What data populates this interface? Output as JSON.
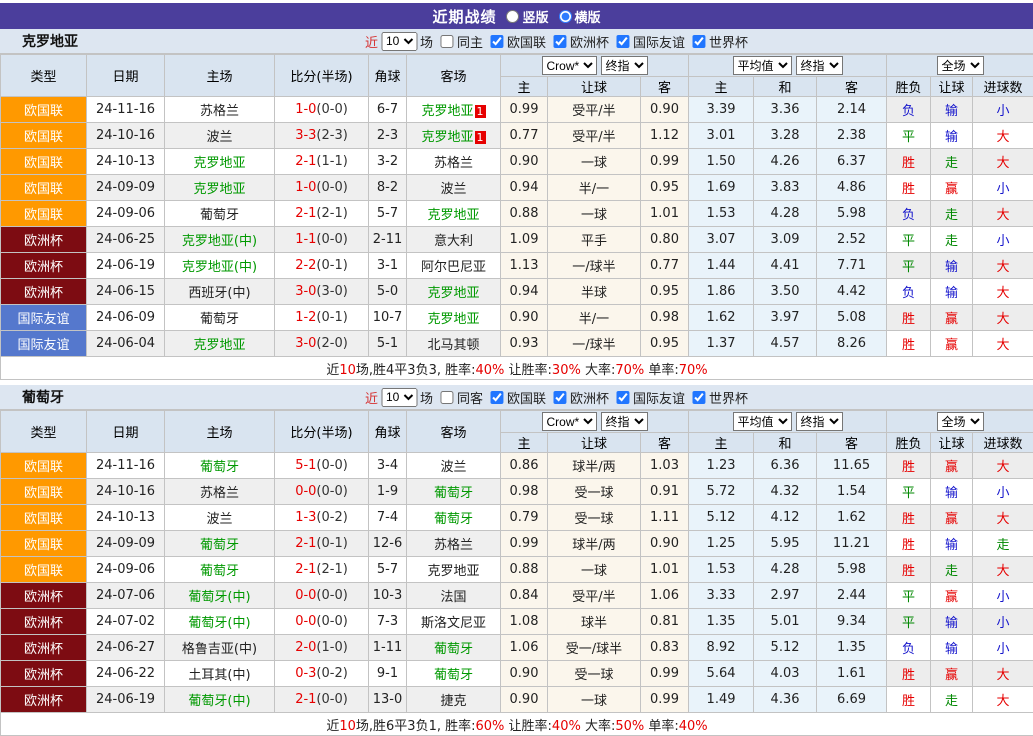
{
  "title_bar": {
    "title": "近期战绩",
    "vertical_label": "竖版",
    "horizontal_label": "横版"
  },
  "league_colors": {
    "欧国联": "#ff9900",
    "欧洲杯": "#7d0c12",
    "国际友谊": "#5578cd"
  },
  "result_colors": {
    "胜": "#e60000",
    "平": "#008800",
    "负": "#1414cc",
    "赢": "#e60000",
    "走": "#008800",
    "输": "#1414cc",
    "大": "#e60000",
    "小": "#1414cc"
  },
  "header_shared": {
    "base_cols": [
      "类型",
      "日期",
      "主场",
      "比分(半场)",
      "角球",
      "客场"
    ],
    "group1": {
      "selects": [
        "Crow*",
        "终指"
      ],
      "cols": [
        "主",
        "让球",
        "客"
      ]
    },
    "group2": {
      "selects": [
        "平均值",
        "终指"
      ],
      "cols": [
        "主",
        "和",
        "客"
      ]
    },
    "group3": {
      "selects": [
        "全场"
      ],
      "cols": [
        "胜负",
        "让球",
        "进球数"
      ]
    }
  },
  "sections": [
    {
      "name": "克罗地亚",
      "filter": {
        "near": "近",
        "count": "10",
        "unit": "场",
        "same": "同主",
        "competitions": [
          "欧国联",
          "欧洲杯",
          "国际友谊",
          "世界杯"
        ]
      },
      "rows": [
        {
          "league": "欧国联",
          "date": "24-11-16",
          "home": {
            "name": "苏格兰",
            "self": false
          },
          "score": "1-0",
          "half": "(0-0)",
          "corner": "6-7",
          "away": {
            "name": "克罗地亚",
            "self": true,
            "badge": "1"
          },
          "crow": [
            "0.99",
            "受平/半",
            "0.90"
          ],
          "avg": [
            "3.39",
            "3.36",
            "2.14"
          ],
          "result": [
            "负",
            "输",
            "小"
          ]
        },
        {
          "league": "欧国联",
          "date": "24-10-16",
          "home": {
            "name": "波兰",
            "self": false
          },
          "score": "3-3",
          "half": "(2-3)",
          "corner": "2-3",
          "away": {
            "name": "克罗地亚",
            "self": true,
            "badge": "1"
          },
          "crow": [
            "0.77",
            "受平/半",
            "1.12"
          ],
          "avg": [
            "3.01",
            "3.28",
            "2.38"
          ],
          "result": [
            "平",
            "输",
            "大"
          ]
        },
        {
          "league": "欧国联",
          "date": "24-10-13",
          "home": {
            "name": "克罗地亚",
            "self": true
          },
          "score": "2-1",
          "half": "(1-1)",
          "corner": "3-2",
          "away": {
            "name": "苏格兰",
            "self": false
          },
          "crow": [
            "0.90",
            "一球",
            "0.99"
          ],
          "avg": [
            "1.50",
            "4.26",
            "6.37"
          ],
          "result": [
            "胜",
            "走",
            "大"
          ]
        },
        {
          "league": "欧国联",
          "date": "24-09-09",
          "home": {
            "name": "克罗地亚",
            "self": true
          },
          "score": "1-0",
          "half": "(0-0)",
          "corner": "8-2",
          "away": {
            "name": "波兰",
            "self": false
          },
          "crow": [
            "0.94",
            "半/一",
            "0.95"
          ],
          "avg": [
            "1.69",
            "3.83",
            "4.86"
          ],
          "result": [
            "胜",
            "赢",
            "小"
          ]
        },
        {
          "league": "欧国联",
          "date": "24-09-06",
          "home": {
            "name": "葡萄牙",
            "self": false
          },
          "score": "2-1",
          "half": "(2-1)",
          "corner": "5-7",
          "away": {
            "name": "克罗地亚",
            "self": true
          },
          "crow": [
            "0.88",
            "一球",
            "1.01"
          ],
          "avg": [
            "1.53",
            "4.28",
            "5.98"
          ],
          "result": [
            "负",
            "走",
            "大"
          ]
        },
        {
          "league": "欧洲杯",
          "date": "24-06-25",
          "home": {
            "name": "克罗地亚(中)",
            "self": true
          },
          "score": "1-1",
          "half": "(0-0)",
          "corner": "2-11",
          "away": {
            "name": "意大利",
            "self": false
          },
          "crow": [
            "1.09",
            "平手",
            "0.80"
          ],
          "avg": [
            "3.07",
            "3.09",
            "2.52"
          ],
          "result": [
            "平",
            "走",
            "小"
          ]
        },
        {
          "league": "欧洲杯",
          "date": "24-06-19",
          "home": {
            "name": "克罗地亚(中)",
            "self": true
          },
          "score": "2-2",
          "half": "(0-1)",
          "corner": "3-1",
          "away": {
            "name": "阿尔巴尼亚",
            "self": false
          },
          "crow": [
            "1.13",
            "一/球半",
            "0.77"
          ],
          "avg": [
            "1.44",
            "4.41",
            "7.71"
          ],
          "result": [
            "平",
            "输",
            "大"
          ]
        },
        {
          "league": "欧洲杯",
          "date": "24-06-15",
          "home": {
            "name": "西班牙(中)",
            "self": false
          },
          "score": "3-0",
          "half": "(3-0)",
          "corner": "5-0",
          "away": {
            "name": "克罗地亚",
            "self": true
          },
          "crow": [
            "0.94",
            "半球",
            "0.95"
          ],
          "avg": [
            "1.86",
            "3.50",
            "4.42"
          ],
          "result": [
            "负",
            "输",
            "大"
          ]
        },
        {
          "league": "国际友谊",
          "date": "24-06-09",
          "home": {
            "name": "葡萄牙",
            "self": false
          },
          "score": "1-2",
          "half": "(0-1)",
          "corner": "10-7",
          "away": {
            "name": "克罗地亚",
            "self": true
          },
          "crow": [
            "0.90",
            "半/一",
            "0.98"
          ],
          "avg": [
            "1.62",
            "3.97",
            "5.08"
          ],
          "result": [
            "胜",
            "赢",
            "大"
          ]
        },
        {
          "league": "国际友谊",
          "date": "24-06-04",
          "home": {
            "name": "克罗地亚",
            "self": true
          },
          "score": "3-0",
          "half": "(2-0)",
          "corner": "5-1",
          "away": {
            "name": "北马其顿",
            "self": false
          },
          "crow": [
            "0.93",
            "一/球半",
            "0.95"
          ],
          "avg": [
            "1.37",
            "4.57",
            "8.26"
          ],
          "result": [
            "胜",
            "赢",
            "大"
          ]
        }
      ],
      "summary": [
        [
          "近",
          0
        ],
        [
          "10",
          1
        ],
        [
          "场,胜4平3负3, 胜率:",
          0
        ],
        [
          "40%",
          1
        ],
        [
          " 让胜率:",
          0
        ],
        [
          "30%",
          1
        ],
        [
          " 大率:",
          0
        ],
        [
          "70%",
          1
        ],
        [
          " 单率:",
          0
        ],
        [
          "70%",
          1
        ]
      ]
    },
    {
      "name": "葡萄牙",
      "filter": {
        "near": "近",
        "count": "10",
        "unit": "场",
        "same": "同客",
        "competitions": [
          "欧国联",
          "欧洲杯",
          "国际友谊",
          "世界杯"
        ]
      },
      "rows": [
        {
          "league": "欧国联",
          "date": "24-11-16",
          "home": {
            "name": "葡萄牙",
            "self": true
          },
          "score": "5-1",
          "half": "(0-0)",
          "corner": "3-4",
          "away": {
            "name": "波兰",
            "self": false
          },
          "crow": [
            "0.86",
            "球半/两",
            "1.03"
          ],
          "avg": [
            "1.23",
            "6.36",
            "11.65"
          ],
          "result": [
            "胜",
            "赢",
            "大"
          ]
        },
        {
          "league": "欧国联",
          "date": "24-10-16",
          "home": {
            "name": "苏格兰",
            "self": false
          },
          "score": "0-0",
          "half": "(0-0)",
          "corner": "1-9",
          "away": {
            "name": "葡萄牙",
            "self": true
          },
          "crow": [
            "0.98",
            "受一球",
            "0.91"
          ],
          "avg": [
            "5.72",
            "4.32",
            "1.54"
          ],
          "result": [
            "平",
            "输",
            "小"
          ]
        },
        {
          "league": "欧国联",
          "date": "24-10-13",
          "home": {
            "name": "波兰",
            "self": false
          },
          "score": "1-3",
          "half": "(0-2)",
          "corner": "7-4",
          "away": {
            "name": "葡萄牙",
            "self": true
          },
          "crow": [
            "0.79",
            "受一球",
            "1.11"
          ],
          "avg": [
            "5.12",
            "4.12",
            "1.62"
          ],
          "result": [
            "胜",
            "赢",
            "大"
          ]
        },
        {
          "league": "欧国联",
          "date": "24-09-09",
          "home": {
            "name": "葡萄牙",
            "self": true
          },
          "score": "2-1",
          "half": "(0-1)",
          "corner": "12-6",
          "away": {
            "name": "苏格兰",
            "self": false
          },
          "crow": [
            "0.99",
            "球半/两",
            "0.90"
          ],
          "avg": [
            "1.25",
            "5.95",
            "11.21"
          ],
          "result": [
            "胜",
            "输",
            "走"
          ]
        },
        {
          "league": "欧国联",
          "date": "24-09-06",
          "home": {
            "name": "葡萄牙",
            "self": true
          },
          "score": "2-1",
          "half": "(2-1)",
          "corner": "5-7",
          "away": {
            "name": "克罗地亚",
            "self": false
          },
          "crow": [
            "0.88",
            "一球",
            "1.01"
          ],
          "avg": [
            "1.53",
            "4.28",
            "5.98"
          ],
          "result": [
            "胜",
            "走",
            "大"
          ]
        },
        {
          "league": "欧洲杯",
          "date": "24-07-06",
          "home": {
            "name": "葡萄牙(中)",
            "self": true
          },
          "score": "0-0",
          "half": "(0-0)",
          "corner": "10-3",
          "away": {
            "name": "法国",
            "self": false
          },
          "crow": [
            "0.84",
            "受平/半",
            "1.06"
          ],
          "avg": [
            "3.33",
            "2.97",
            "2.44"
          ],
          "result": [
            "平",
            "赢",
            "小"
          ]
        },
        {
          "league": "欧洲杯",
          "date": "24-07-02",
          "home": {
            "name": "葡萄牙(中)",
            "self": true
          },
          "score": "0-0",
          "half": "(0-0)",
          "corner": "7-3",
          "away": {
            "name": "斯洛文尼亚",
            "self": false
          },
          "crow": [
            "1.08",
            "球半",
            "0.81"
          ],
          "avg": [
            "1.35",
            "5.01",
            "9.34"
          ],
          "result": [
            "平",
            "输",
            "小"
          ]
        },
        {
          "league": "欧洲杯",
          "date": "24-06-27",
          "home": {
            "name": "格鲁吉亚(中)",
            "self": false
          },
          "score": "2-0",
          "half": "(1-0)",
          "corner": "1-11",
          "away": {
            "name": "葡萄牙",
            "self": true
          },
          "crow": [
            "1.06",
            "受一/球半",
            "0.83"
          ],
          "avg": [
            "8.92",
            "5.12",
            "1.35"
          ],
          "result": [
            "负",
            "输",
            "小"
          ]
        },
        {
          "league": "欧洲杯",
          "date": "24-06-22",
          "home": {
            "name": "土耳其(中)",
            "self": false
          },
          "score": "0-3",
          "half": "(0-2)",
          "corner": "9-1",
          "away": {
            "name": "葡萄牙",
            "self": true
          },
          "crow": [
            "0.90",
            "受一球",
            "0.99"
          ],
          "avg": [
            "5.64",
            "4.03",
            "1.61"
          ],
          "result": [
            "胜",
            "赢",
            "大"
          ]
        },
        {
          "league": "欧洲杯",
          "date": "24-06-19",
          "home": {
            "name": "葡萄牙(中)",
            "self": true
          },
          "score": "2-1",
          "half": "(0-0)",
          "corner": "13-0",
          "away": {
            "name": "捷克",
            "self": false
          },
          "crow": [
            "0.90",
            "一球",
            "0.99"
          ],
          "avg": [
            "1.49",
            "4.36",
            "6.69"
          ],
          "result": [
            "胜",
            "走",
            "大"
          ]
        }
      ],
      "summary": [
        [
          "近",
          0
        ],
        [
          "10",
          1
        ],
        [
          "场,胜6平3负1, 胜率:",
          0
        ],
        [
          "60%",
          1
        ],
        [
          " 让胜率:",
          0
        ],
        [
          "40%",
          1
        ],
        [
          " 大率:",
          0
        ],
        [
          "50%",
          1
        ],
        [
          " 单率:",
          0
        ],
        [
          "40%",
          1
        ]
      ]
    }
  ]
}
